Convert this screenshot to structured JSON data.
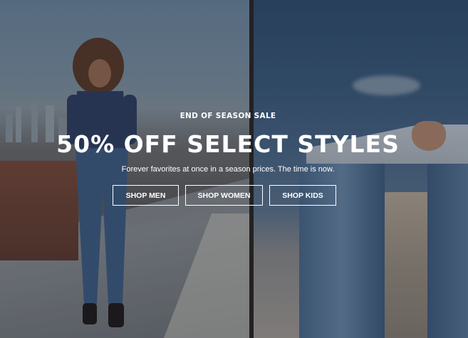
{
  "hero": {
    "eyebrow": "END OF SEASON SALE",
    "headline": "50% OFF SELECT STYLES",
    "subtext": "Forever favorites at once in a season prices. The time is now.",
    "buttons": {
      "men": "SHOP MEN",
      "women": "SHOP WOMEN",
      "kids": "SHOP KIDS"
    }
  },
  "colors": {
    "text": "#ffffff",
    "button_border": "#ffffff"
  }
}
